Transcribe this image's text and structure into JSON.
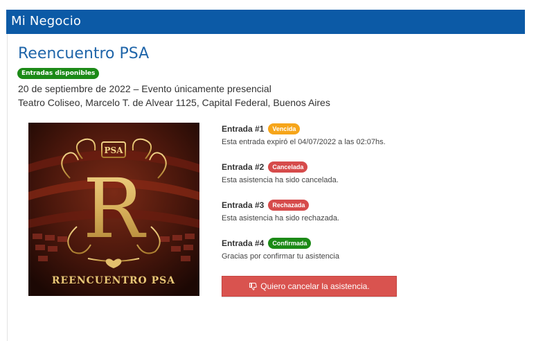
{
  "header": {
    "title": "Mi Negocio",
    "color": "#0c5aa6"
  },
  "event": {
    "title": "Reencuentro PSA",
    "availability_badge": "Entradas disponibles",
    "date_line": "20 de septiembre de 2022 – Evento únicamente presencial",
    "venue_line": "Teatro Coliseo, Marcelo T. de Alvear 1125, Capital Federal, Buenos Aires"
  },
  "poster": {
    "logo_text": "PSA",
    "letter": "R",
    "caption": "REENCUENTRO PSA"
  },
  "tickets": [
    {
      "label": "Entrada #1",
      "status": "Vencida",
      "status_color": "#f6a51a",
      "description": "Esta entrada expiró el 04/07/2022 a las 02:07hs."
    },
    {
      "label": "Entrada #2",
      "status": "Cancelada",
      "status_color": "#d64b4b",
      "description": "Esta asistencia ha sido cancelada."
    },
    {
      "label": "Entrada #3",
      "status": "Rechazada",
      "status_color": "#d64b4b",
      "description": "Esta asistencia ha sido rechazada."
    },
    {
      "label": "Entrada #4",
      "status": "Confirmada",
      "status_color": "#1c8a17",
      "description": "Gracias por confirmar tu asistencia"
    }
  ],
  "cancel_button": {
    "label": "Quiero cancelar la asistencia.",
    "icon": "thumbs-down-icon",
    "color": "#d9534f"
  }
}
